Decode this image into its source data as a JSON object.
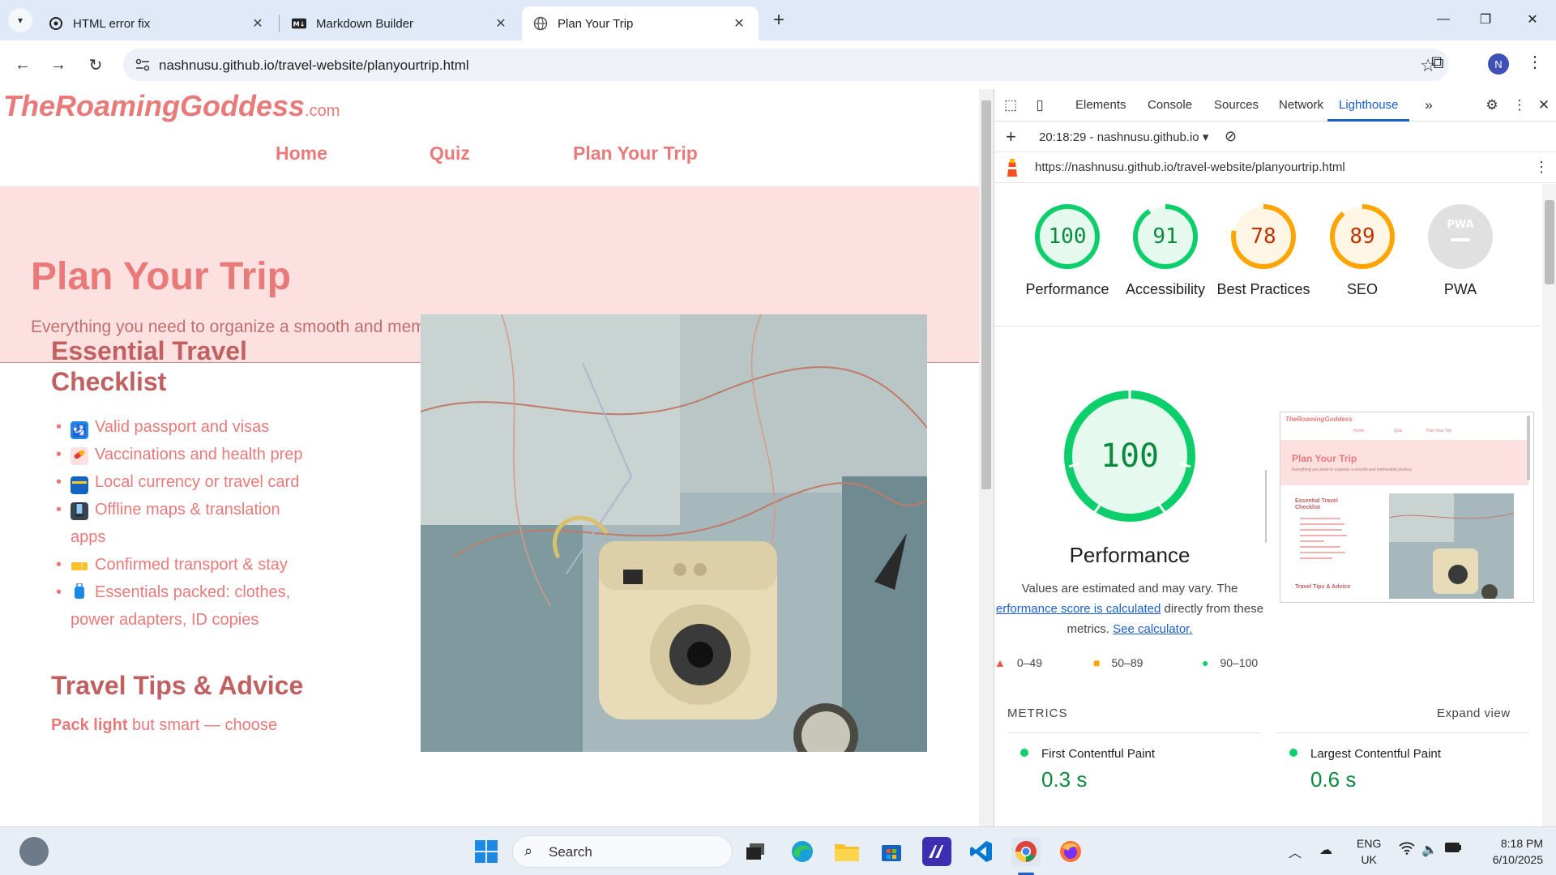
{
  "browser": {
    "tabs": [
      {
        "label": "HTML error fix",
        "icon": "chatgpt-icon"
      },
      {
        "label": "Markdown Builder",
        "icon": "markdown-icon"
      },
      {
        "label": "Plan Your Trip",
        "icon": "globe-icon",
        "active": true
      }
    ],
    "url": "nashnusu.github.io/travel-website/planyourtrip.html",
    "profile_initial": "N"
  },
  "page": {
    "logo": "TheRoamingGoddess",
    "logo_tld": ".com",
    "nav": [
      "Home",
      "Quiz",
      "Plan Your Trip"
    ],
    "hero_title": "Plan Your Trip",
    "hero_subtitle": "Everything you need to organize a smooth and memorable journey.",
    "checklist_title": "Essential Travel Checklist",
    "checklist": [
      {
        "icon": "passport-icon",
        "text": "Valid passport and visas"
      },
      {
        "icon": "pill-icon",
        "text": "Vaccinations and health prep"
      },
      {
        "icon": "credit-card-icon",
        "text": "Local currency or travel card"
      },
      {
        "icon": "phone-icon",
        "text": "Offline maps & translation apps"
      },
      {
        "icon": "ticket-icon",
        "text": "Confirmed transport & stay"
      },
      {
        "icon": "luggage-icon",
        "text": "Essentials packed: clothes, power adapters, ID copies"
      }
    ],
    "tips_title": "Travel Tips & Advice",
    "tips_bold": "Pack light",
    "tips_rest": " but smart — choose"
  },
  "devtools": {
    "tabs": [
      "Elements",
      "Console",
      "Sources",
      "Network",
      "Lighthouse"
    ],
    "active_tab": "Lighthouse",
    "report_selector": "20:18:29 - nashnusu.github.io",
    "report_url": "https://nashnusu.github.io/travel-website/planyourtrip.html",
    "scores": [
      {
        "label": "Performance",
        "value": "100",
        "color": "#0cce6b"
      },
      {
        "label": "Accessibility",
        "value": "91",
        "color": "#0cce6b"
      },
      {
        "label": "Best Practices",
        "value": "78",
        "color": "#ffa400"
      },
      {
        "label": "SEO",
        "value": "89",
        "color": "#ffa400"
      },
      {
        "label": "PWA",
        "value": "PWA",
        "color": "#cccccc"
      }
    ],
    "main_score": "100",
    "main_label": "Performance",
    "desc_prefix": "Values are estimated and may vary. The",
    "desc_link1": "erformance score is calculated",
    "desc_mid": " directly from these metrics.",
    "desc_link2": "See calculator.",
    "legend": [
      "0–49",
      "50–89",
      "90–100"
    ],
    "metrics_header": "METRICS",
    "expand_label": "Expand view",
    "metrics": [
      {
        "name": "First Contentful Paint",
        "value": "0.3 s"
      },
      {
        "name": "Largest Contentful Paint",
        "value": "0.6 s"
      }
    ],
    "thumb": {
      "logo": "TheRoamingGoddess",
      "nav": [
        "Home",
        "Quiz",
        "Plan Your Trip"
      ],
      "title": "Plan Your Trip",
      "subtitle": "Everything you need to organize a smooth and memorable journey.",
      "checklist_title": "Essential Travel Checklist",
      "tips_title": "Travel Tips & Advice"
    }
  },
  "taskbar": {
    "search_placeholder": "Search",
    "lang_top": "ENG",
    "lang_bottom": "UK",
    "time": "8:18 PM",
    "date": "6/10/2025"
  }
}
